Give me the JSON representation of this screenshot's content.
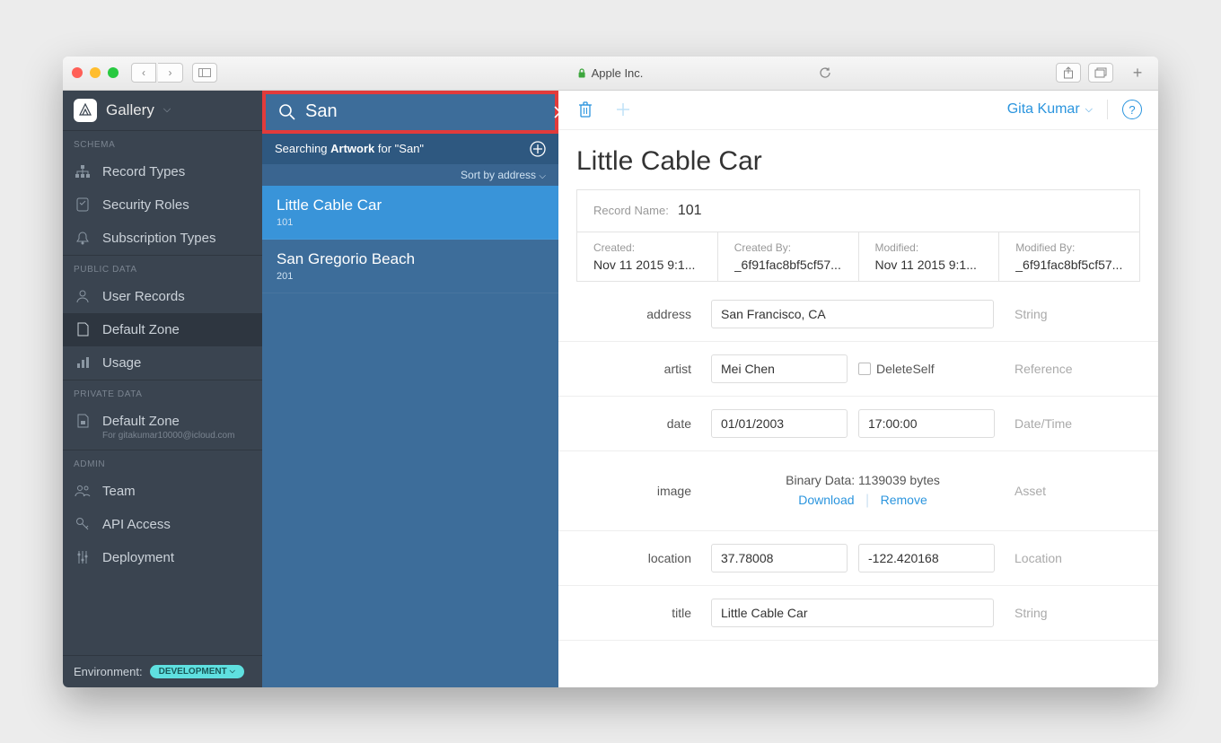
{
  "browser": {
    "url_host": "Apple Inc."
  },
  "sidebar": {
    "app_name": "Gallery",
    "sections": {
      "schema": "SCHEMA",
      "public": "PUBLIC DATA",
      "private": "PRIVATE DATA",
      "admin": "ADMIN"
    },
    "items": {
      "record_types": "Record Types",
      "security_roles": "Security Roles",
      "subscription_types": "Subscription Types",
      "user_records": "User Records",
      "default_zone": "Default Zone",
      "usage": "Usage",
      "priv_default_zone": "Default Zone",
      "priv_default_zone_sub": "For gitakumar10000@icloud.com",
      "team": "Team",
      "api_access": "API Access",
      "deployment": "Deployment"
    },
    "env_label": "Environment:",
    "env_value": "DEVELOPMENT"
  },
  "search": {
    "query": "San",
    "searching_prefix": "Searching ",
    "searching_entity": "Artwork",
    "searching_suffix": " for \"San\"",
    "sort_label": "Sort by address",
    "results": [
      {
        "title": "Little Cable Car",
        "id": "101"
      },
      {
        "title": "San Gregorio Beach",
        "id": "201"
      }
    ]
  },
  "detail": {
    "user": "Gita Kumar",
    "title": "Little Cable Car",
    "record_name_label": "Record Name:",
    "record_name": "101",
    "meta": {
      "created_label": "Created:",
      "created": "Nov 11 2015 9:1...",
      "created_by_label": "Created By:",
      "created_by": "_6f91fac8bf5cf57...",
      "modified_label": "Modified:",
      "modified": "Nov 11 2015 9:1...",
      "modified_by_label": "Modified By:",
      "modified_by": "_6f91fac8bf5cf57..."
    },
    "fields": {
      "address_label": "address",
      "address_value": "San Francisco, CA",
      "address_type": "String",
      "artist_label": "artist",
      "artist_value": "Mei Chen",
      "artist_delete_self": "DeleteSelf",
      "artist_type": "Reference",
      "date_label": "date",
      "date_value": "01/01/2003",
      "time_value": "17:00:00",
      "date_type": "Date/Time",
      "image_label": "image",
      "image_binary": "Binary Data: 1139039 bytes",
      "download": "Download",
      "remove": "Remove",
      "image_type": "Asset",
      "location_label": "location",
      "lat": "37.78008",
      "lon": "-122.420168",
      "location_type": "Location",
      "title_label": "title",
      "title_value": "Little Cable Car",
      "title_type": "String"
    }
  }
}
